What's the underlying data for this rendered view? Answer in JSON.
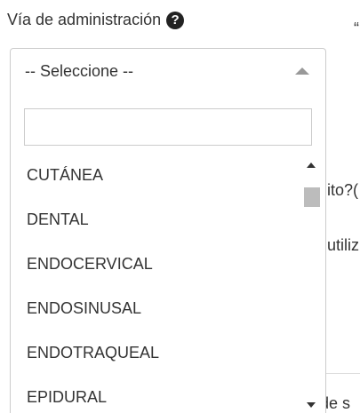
{
  "field": {
    "label": "Vía de administración",
    "help_icon": "?"
  },
  "background": {
    "quote": "“",
    "line1": "ito?(",
    "line2": "utiliz",
    "line3": "de s"
  },
  "select": {
    "selected_value": "-- Seleccione --",
    "search_value": "",
    "search_placeholder": "",
    "options": [
      "CUTÁNEA",
      "DENTAL",
      "ENDOCERVICAL",
      "ENDOSINUSAL",
      "ENDOTRAQUEAL",
      "EPIDURAL"
    ]
  },
  "colors": {
    "text": "#333333",
    "border": "#cccccc",
    "scroll_thumb": "#bcbcbc",
    "help_icon_bg": "#222222"
  }
}
